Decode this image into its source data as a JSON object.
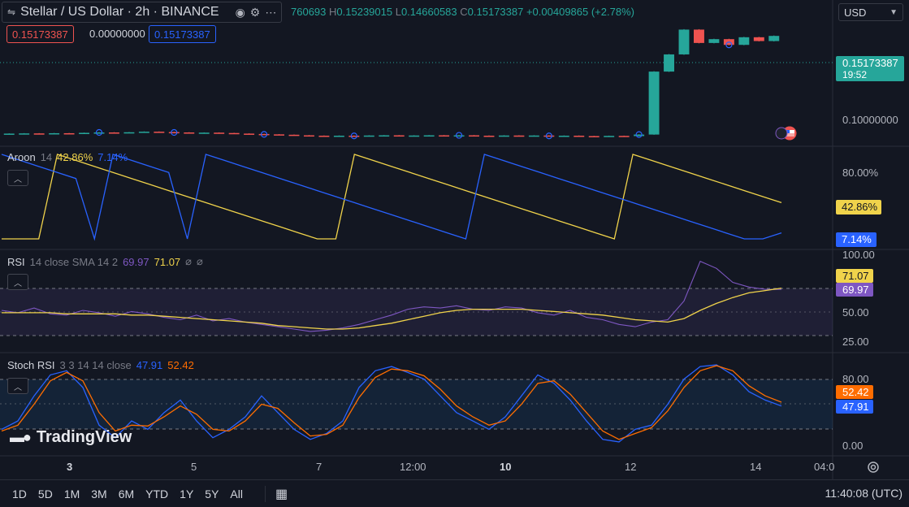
{
  "header": {
    "symbol_title": "Stellar / US Dollar · 2h · BINANCE",
    "ohlc_open_fragment": "760693",
    "ohlc_high_label": "H",
    "ohlc_high": "0.15239015",
    "ohlc_low_label": "L",
    "ohlc_low": "0.14660583",
    "ohlc_close_label": "C",
    "ohlc_close": "0.15173387",
    "ohlc_change": "+0.00409865 (+2.78%)",
    "bid": "0.15173387",
    "spread": "0.00000000",
    "ask": "0.15173387",
    "currency": "USD"
  },
  "price_axis": {
    "last_price": "0.15173387",
    "countdown": "19:52",
    "level_label": "0.10000000"
  },
  "aroon": {
    "name": "Aroon",
    "length": "14",
    "up_value": "42.86%",
    "down_value": "7.14%",
    "axis_label": "80.00%",
    "up_badge": "42.86%",
    "down_badge": "7.14%"
  },
  "rsi": {
    "name": "RSI",
    "params": "14 close SMA 14 2",
    "rsi_value": "69.97",
    "ma_value": "71.07",
    "extra1": "⌀",
    "extra2": "⌀",
    "axis_labels": [
      "100.00",
      "50.00",
      "25.00"
    ],
    "rsi_badge": "69.97",
    "ma_badge": "71.07"
  },
  "stoch": {
    "name": "Stoch RSI",
    "params": "3 3 14 14 close",
    "k_value": "47.91",
    "d_value": "52.42",
    "axis_labels": [
      "80.00",
      "0.00"
    ],
    "d_badge": "52.42",
    "k_badge": "47.91"
  },
  "time_axis": {
    "labels": [
      "3",
      "5",
      "7",
      "12:00",
      "10",
      "12",
      "14",
      "04:0"
    ]
  },
  "bottom_bar": {
    "timeframes": [
      "1D",
      "5D",
      "1M",
      "3M",
      "6M",
      "YTD",
      "1Y",
      "5Y",
      "All"
    ],
    "clock": "11:40:08 (UTC)"
  },
  "watermark": "TradingView",
  "colors": {
    "background": "#131722",
    "up_candle": "#26a69a",
    "down_candle": "#ef5350",
    "aroon_up": "#f0d34b",
    "aroon_down": "#2962ff",
    "rsi_line": "#7e57c2",
    "rsi_ma": "#f0d34b",
    "stoch_k": "#2962ff",
    "stoch_d": "#ff6d00"
  },
  "icons": [
    "symbol-icon",
    "eye-icon",
    "settings-icon",
    "more-icon",
    "chevron-up-icon",
    "date-range-icon",
    "settings-gear-icon",
    "tradingview-logo-icon",
    "us-flag-icon"
  ],
  "chart_data": [
    {
      "type": "candlestick",
      "title": "Stellar / US Dollar · 2h · BINANCE",
      "last_close": 0.15173387,
      "y_ticks": [
        0.1
      ],
      "description_series": "close",
      "close": [
        0.1005,
        0.1006,
        0.1004,
        0.1007,
        0.1006,
        0.1009,
        0.1011,
        0.101,
        0.1012,
        0.1015,
        0.1013,
        0.1011,
        0.1009,
        0.101,
        0.1008,
        0.1005,
        0.1003,
        0.1001,
        0.0999,
        0.0996,
        0.0994,
        0.0992,
        0.0994,
        0.0993,
        0.0995,
        0.0996,
        0.0994,
        0.0995,
        0.0996,
        0.0995,
        0.0996,
        0.0994,
        0.0993,
        0.0995,
        0.0994,
        0.0995,
        0.0993,
        0.0994,
        0.0992,
        0.0991,
        0.0993,
        0.0992,
        0.1,
        0.133,
        0.142,
        0.155,
        0.148,
        0.15,
        0.147,
        0.151,
        0.149,
        0.1517
      ]
    },
    {
      "type": "line",
      "title": "Aroon 14",
      "ylim": [
        0,
        100
      ],
      "series": [
        {
          "name": "Aroon Up",
          "last": 42.86,
          "values": [
            0,
            0,
            0,
            100,
            92.86,
            85.71,
            78.57,
            71.43,
            64.29,
            57.14,
            50,
            42.86,
            35.71,
            28.57,
            21.43,
            14.29,
            7.14,
            0,
            0,
            100,
            92.86,
            85.71,
            78.57,
            71.43,
            64.29,
            57.14,
            50,
            42.86,
            35.71,
            28.57,
            21.43,
            14.29,
            7.14,
            0,
            100,
            92.86,
            85.71,
            78.57,
            71.43,
            64.29,
            57.14,
            50,
            42.86
          ]
        },
        {
          "name": "Aroon Down",
          "last": 7.14,
          "values": [
            100,
            92.86,
            85.71,
            78.57,
            71.43,
            0,
            100,
            92.86,
            85.71,
            78.57,
            0,
            100,
            92.86,
            85.71,
            78.57,
            71.43,
            64.29,
            57.14,
            50,
            42.86,
            35.71,
            28.57,
            21.43,
            14.29,
            7.14,
            0,
            100,
            92.86,
            85.71,
            78.57,
            71.43,
            64.29,
            57.14,
            50,
            42.86,
            35.71,
            28.57,
            21.43,
            14.29,
            7.14,
            0,
            0,
            7.14
          ]
        }
      ]
    },
    {
      "type": "line",
      "title": "RSI 14 close SMA 14 2",
      "ylim": [
        20,
        100
      ],
      "series": [
        {
          "name": "RSI",
          "last": 69.97,
          "values": [
            52,
            50,
            54,
            49,
            48,
            52,
            50,
            47,
            51,
            49,
            46,
            44,
            48,
            43,
            45,
            42,
            40,
            38,
            36,
            34,
            35,
            37,
            40,
            44,
            48,
            53,
            55,
            54,
            56,
            53,
            52,
            55,
            54,
            50,
            48,
            52,
            46,
            44,
            40,
            38,
            42,
            44,
            60,
            94,
            88,
            76,
            72,
            70,
            69.97
          ]
        },
        {
          "name": "RSI-based MA",
          "last": 71.07,
          "values": [
            50,
            50,
            50,
            50,
            49,
            49,
            49,
            49,
            48,
            48,
            47,
            46,
            45,
            44,
            43,
            42,
            41,
            39,
            38,
            37,
            36,
            36,
            37,
            39,
            41,
            44,
            47,
            50,
            52,
            53,
            53,
            53,
            53,
            52,
            51,
            50,
            49,
            48,
            46,
            44,
            43,
            42,
            45,
            52,
            58,
            63,
            67,
            69,
            71.07
          ]
        }
      ]
    },
    {
      "type": "line",
      "title": "Stoch RSI 3 3 14 14 close",
      "ylim": [
        0,
        100
      ],
      "series": [
        {
          "name": "K",
          "last": 47.91,
          "values": [
            20,
            30,
            60,
            85,
            90,
            70,
            25,
            10,
            30,
            20,
            40,
            55,
            30,
            10,
            20,
            35,
            60,
            40,
            20,
            8,
            15,
            30,
            70,
            90,
            95,
            88,
            80,
            60,
            40,
            30,
            20,
            35,
            60,
            85,
            75,
            55,
            30,
            8,
            5,
            20,
            25,
            50,
            80,
            95,
            97,
            85,
            65,
            55,
            47.91
          ]
        },
        {
          "name": "D",
          "last": 52.42,
          "values": [
            18,
            25,
            50,
            78,
            88,
            78,
            40,
            18,
            25,
            24,
            35,
            48,
            38,
            20,
            18,
            30,
            50,
            45,
            28,
            12,
            14,
            25,
            58,
            82,
            92,
            90,
            84,
            68,
            48,
            35,
            25,
            30,
            50,
            75,
            78,
            62,
            40,
            18,
            8,
            15,
            22,
            42,
            70,
            90,
            96,
            90,
            72,
            60,
            52.42
          ]
        }
      ]
    }
  ]
}
